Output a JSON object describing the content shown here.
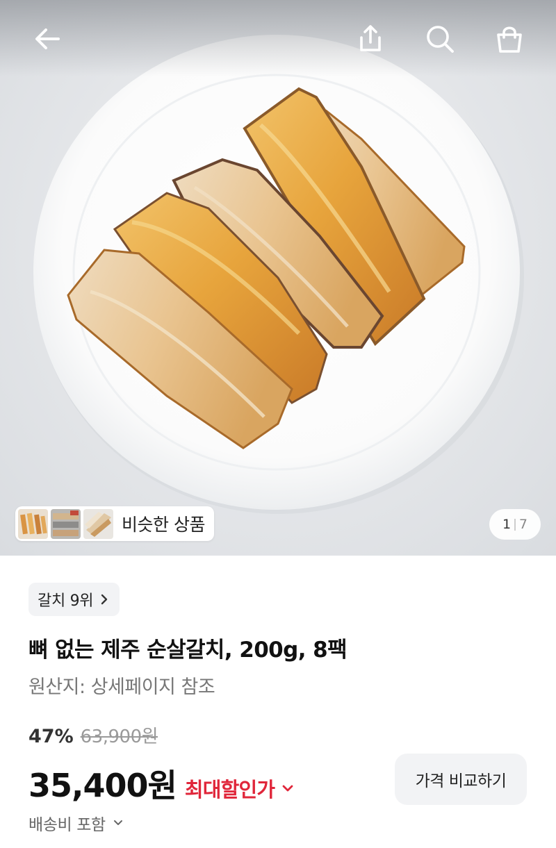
{
  "colors": {
    "accent_red": "#e0263a",
    "chip_bg": "#f2f3f5",
    "text_primary": "#111111",
    "text_secondary": "#777777"
  },
  "topbar": {
    "icons": [
      "back-arrow-icon",
      "share-icon",
      "search-icon",
      "cart-bag-icon"
    ]
  },
  "gallery": {
    "similar_label": "비슷한 상품",
    "current_page": "1",
    "page_separator": "|",
    "total_pages": "7"
  },
  "product": {
    "rank_label": "갈치 9위",
    "title": "뼈 없는 제주 순살갈치, 200g, 8팩",
    "origin": "원산지: 상세페이지 참조",
    "discount_percent": "47%",
    "original_price": "63,900원",
    "price": "35,400원",
    "max_discount_label": "최대할인가",
    "compare_button": "가격 비교하기",
    "shipping_label": "배송비 포함"
  }
}
